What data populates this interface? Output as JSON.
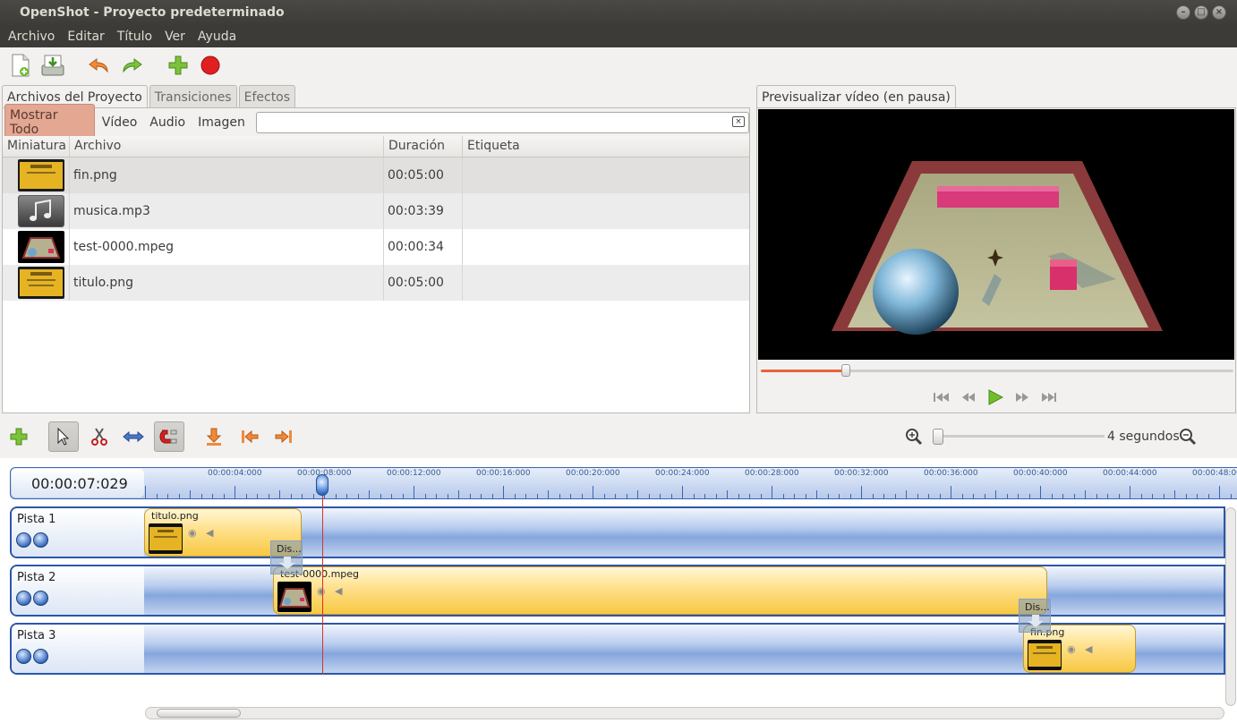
{
  "window": {
    "title": "OpenShot - Proyecto predeterminado"
  },
  "menu": [
    "Archivo",
    "Editar",
    "Título",
    "Ver",
    "Ayuda"
  ],
  "project_tabs": [
    "Archivos del Proyecto",
    "Transiciones",
    "Efectos"
  ],
  "filters": [
    "Mostrar Todo",
    "Vídeo",
    "Audio",
    "Imagen"
  ],
  "search": {
    "value": ""
  },
  "table": {
    "headers": [
      "Miniatura",
      "Archivo",
      "Duración",
      "Etiqueta"
    ],
    "rows": [
      {
        "file": "fin.png",
        "duration": "00:05:00",
        "tag": "",
        "thumb": "image"
      },
      {
        "file": "musica.mp3",
        "duration": "00:03:39",
        "tag": "",
        "thumb": "audio"
      },
      {
        "file": "test-0000.mpeg",
        "duration": "00:00:34",
        "tag": "",
        "thumb": "video"
      },
      {
        "file": "titulo.png",
        "duration": "00:05:00",
        "tag": "",
        "thumb": "image"
      }
    ]
  },
  "preview": {
    "tab": "Previsualizar vídeo (en pausa)",
    "progress_fraction": 0.18
  },
  "timeline": {
    "zoom_label": "4 segundos",
    "timecode": "00:00:07:029",
    "ruler_labels": [
      "00:00:04:000",
      "00:00:08:000",
      "00:00:12:000",
      "00:00:16:000",
      "00:00:20:000",
      "00:00:24:000",
      "00:00:28:000",
      "00:00:32:000",
      "00:00:36:000",
      "00:00:40:000",
      "00:00:44:000",
      "00:00:48:00"
    ],
    "tracks": [
      {
        "name": "Pista 1",
        "clips": [
          {
            "name": "titulo.png"
          }
        ]
      },
      {
        "name": "Pista 2",
        "clips": [
          {
            "name": "test-0000.mpeg"
          }
        ],
        "transitions": [
          {
            "name": "Dis..."
          }
        ]
      },
      {
        "name": "Pista 3",
        "clips": [
          {
            "name": "fin.png"
          }
        ],
        "transitions": [
          {
            "name": "Dis..."
          }
        ]
      }
    ]
  },
  "colors": {
    "accent": "#e8643a",
    "track_border": "#2d56a8",
    "clip_fill": "#ffe08a",
    "playhead": "#d9302c"
  }
}
